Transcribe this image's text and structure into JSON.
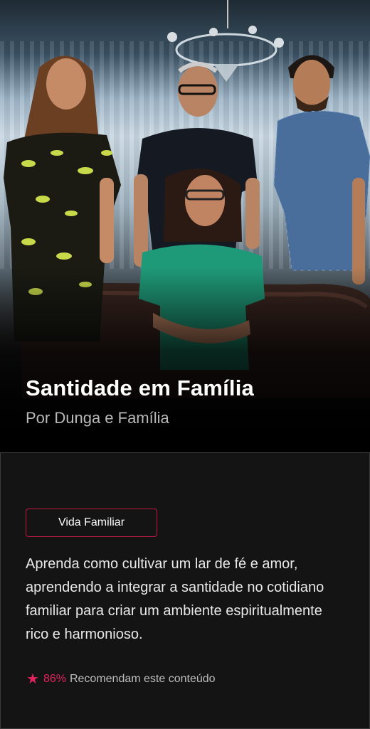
{
  "hero": {
    "title": "Santidade em Família",
    "subtitle": "Por Dunga e Família",
    "image_alt": "family-photo"
  },
  "content": {
    "tag": "Vida Familiar",
    "description": "Aprenda como cultivar um lar de fé e amor, aprendendo a integrar a santidade no cotidiano familiar para criar um ambiente espiritualmente rico e harmonioso.",
    "rating_percent": "86%",
    "rating_text": "Recomendam este conteúdo",
    "accent_color": "#e0245e",
    "star_icon": "star-icon"
  }
}
